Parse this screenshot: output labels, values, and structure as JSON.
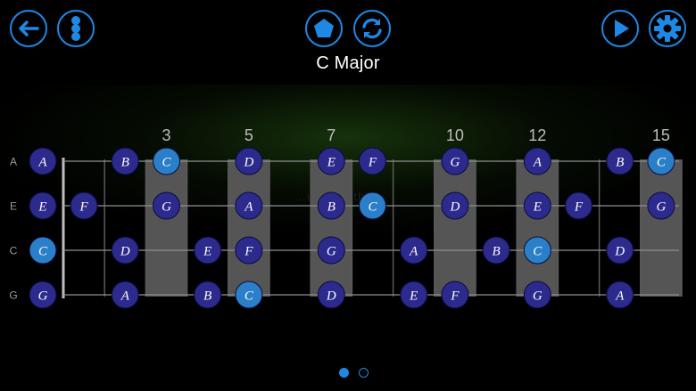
{
  "title": "C Major",
  "watermark": "…ular …other",
  "toolbar": {
    "back": "back-arrow-icon",
    "menu": "more-vertical-icon",
    "shape": "pentagon-icon",
    "refresh": "refresh-icon",
    "play": "play-icon",
    "settings": "gear-icon",
    "accent": "#1e88e5"
  },
  "fretboard": {
    "strings": [
      "A",
      "E",
      "C",
      "G"
    ],
    "fret_numbers": [
      3,
      5,
      7,
      10,
      12,
      15
    ],
    "inlay_frets": [
      3,
      5,
      7,
      10,
      12,
      15
    ],
    "num_frets": 15,
    "notes": [
      [
        "A",
        "",
        "B",
        "C",
        "",
        "D",
        "",
        "E",
        "F",
        "",
        "G",
        "",
        "A",
        "",
        "B",
        "C"
      ],
      [
        "E",
        "F",
        "",
        "G",
        "",
        "A",
        "",
        "B",
        "C",
        "",
        "D",
        "",
        "E",
        "F",
        "",
        "G"
      ],
      [
        "C",
        "",
        "D",
        "",
        "E",
        "F",
        "",
        "G",
        "",
        "A",
        "",
        "B",
        "C",
        "",
        "D",
        ""
      ],
      [
        "G",
        "",
        "A",
        "",
        "B",
        "C",
        "",
        "D",
        "",
        "E",
        "F",
        "",
        "G",
        "",
        "A",
        ""
      ]
    ],
    "root": "C",
    "colors": {
      "note_fill": "#2c2a8c",
      "root_fill": "#2a7fc8",
      "inlay": "#555555",
      "string": "#8f8f8f",
      "fret": "#5a5a5a",
      "nut": "#bdbdbd"
    }
  },
  "pager": {
    "pages": 2,
    "current": 1
  }
}
